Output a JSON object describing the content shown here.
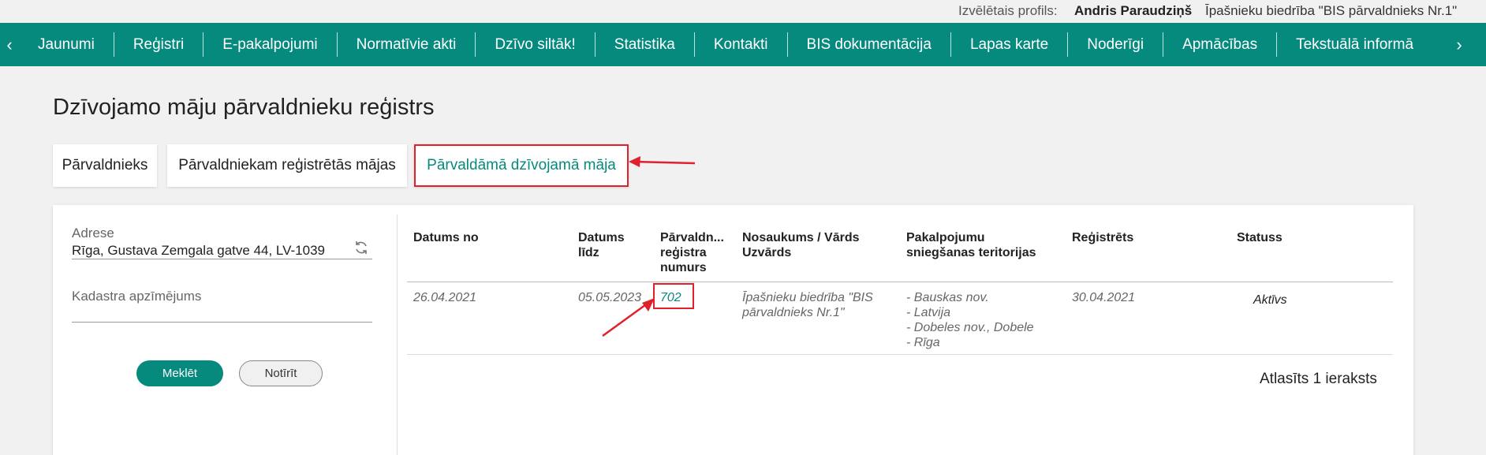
{
  "profile": {
    "label": "Izvēlētais profils:",
    "name": "Andris Paraudziņš",
    "organization": "Īpašnieku biedrība \"BIS pārvaldnieks Nr.1\""
  },
  "nav": {
    "prev_icon": "chevron-left-icon",
    "next_icon": "chevron-right-icon",
    "items": [
      {
        "label": "Jaunumi"
      },
      {
        "label": "Reģistri"
      },
      {
        "label": "E-pakalpojumi"
      },
      {
        "label": "Normatīvie akti"
      },
      {
        "label": "Dzīvo siltāk!"
      },
      {
        "label": "Statistika"
      },
      {
        "label": "Kontakti"
      },
      {
        "label": "BIS dokumentācija"
      },
      {
        "label": "Lapas karte"
      },
      {
        "label": "Noderīgi"
      },
      {
        "label": "Apmācības"
      },
      {
        "label": "Tekstuālā informā"
      }
    ]
  },
  "page": {
    "title": "Dzīvojamo māju pārvaldnieku reģistrs"
  },
  "tabs": [
    {
      "label": "Pārvaldnieks"
    },
    {
      "label": "Pārvaldniekam reģistrētās mājas"
    },
    {
      "label": "Pārvaldāmā dzīvojamā māja",
      "active": true
    }
  ],
  "filters": {
    "address": {
      "label": "Adrese",
      "value": "Rīga, Gustava Zemgala gatve 44, LV-1039"
    },
    "cadastre": {
      "label": "Kadastra apzīmējums",
      "value": ""
    },
    "search_label": "Meklēt",
    "clear_label": "Notīrīt"
  },
  "table": {
    "headers": {
      "date_from": "Datums no",
      "date_to_1": "Datums",
      "date_to_2": "līdz",
      "reg_1": "Pārvaldn...",
      "reg_2": "reģistra",
      "reg_3": "numurs",
      "name_1": "Nosaukums / Vārds",
      "name_2": "Uzvārds",
      "terr_1": "Pakalpojumu",
      "terr_2": "sniegšanas teritorijas",
      "registered": "Reģistrēts",
      "status": "Statuss"
    },
    "rows": [
      {
        "date_from": "26.04.2021",
        "date_to": "05.05.2023",
        "reg_number": "702",
        "name_1": "Īpašnieku biedrība \"BIS",
        "name_2": "pārvaldnieks Nr.1\"",
        "territories": [
          "- Bauskas nov.",
          "- Latvija",
          "- Dobeles nov., Dobele",
          "- Rīga"
        ],
        "registered": "30.04.2021",
        "status": "Aktīvs"
      }
    ],
    "result_count": "Atlasīts 1 ieraksts"
  },
  "colors": {
    "brand": "#068a7e",
    "highlight": "#e0202b"
  }
}
